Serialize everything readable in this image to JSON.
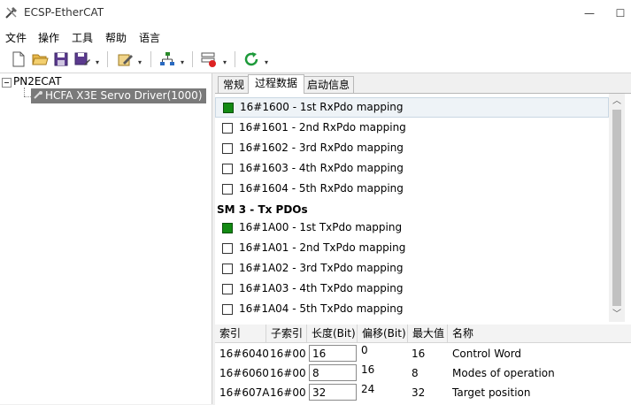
{
  "window": {
    "title": "ECSP-EtherCAT",
    "minimize_glyph": "—",
    "maximize_glyph": "☐"
  },
  "menu": [
    "文件",
    "操作",
    "工具",
    "帮助",
    "语言"
  ],
  "toolbar_icons": [
    "new-file-icon",
    "open-folder-icon",
    "save-icon",
    "save-as-icon",
    "edit-settings-icon",
    "network-topology-icon",
    "device-config-icon",
    "refresh-icon"
  ],
  "tree": {
    "root": "PN2ECAT",
    "child": "HCFA X3E Servo Driver(1000)"
  },
  "tabs": [
    "常规",
    "过程数据",
    "启动信息"
  ],
  "active_tab": "过程数据",
  "pdo_rx": [
    {
      "id": "16#1600",
      "name": "1st RxPdo mapping",
      "checked": true
    },
    {
      "id": "16#1601",
      "name": "2nd RxPdo mapping",
      "checked": false
    },
    {
      "id": "16#1602",
      "name": "3rd RxPdo mapping",
      "checked": false
    },
    {
      "id": "16#1603",
      "name": "4th RxPdo mapping",
      "checked": false
    },
    {
      "id": "16#1604",
      "name": "5th RxPdo mapping",
      "checked": false
    }
  ],
  "section_tx": "SM 3 - Tx PDOs",
  "pdo_tx": [
    {
      "id": "16#1A00",
      "name": "1st TxPdo mapping",
      "checked": true
    },
    {
      "id": "16#1A01",
      "name": "2nd TxPdo mapping",
      "checked": false
    },
    {
      "id": "16#1A02",
      "name": "3rd TxPdo mapping",
      "checked": false
    },
    {
      "id": "16#1A03",
      "name": "4th TxPdo mapping",
      "checked": false
    },
    {
      "id": "16#1A04",
      "name": "5th TxPdo mapping",
      "checked": false
    }
  ],
  "grid": {
    "headers": [
      "索引",
      "子索引",
      "长度(Bit)",
      "偏移(Bit)",
      "最大值",
      "名称"
    ],
    "rows": [
      {
        "index": "16#6040",
        "subindex": "16#00",
        "length": "16",
        "offset": "0",
        "max": "16",
        "name": "Control Word"
      },
      {
        "index": "16#6060",
        "subindex": "16#00",
        "length": "8",
        "offset": "16",
        "max": "8",
        "name": "Modes of operation"
      },
      {
        "index": "16#607A",
        "subindex": "16#00",
        "length": "32",
        "offset": "24",
        "max": "32",
        "name": "Target position"
      }
    ]
  },
  "colors": {
    "checked": "#138a13",
    "tree_selected": "#7a7a7a"
  }
}
